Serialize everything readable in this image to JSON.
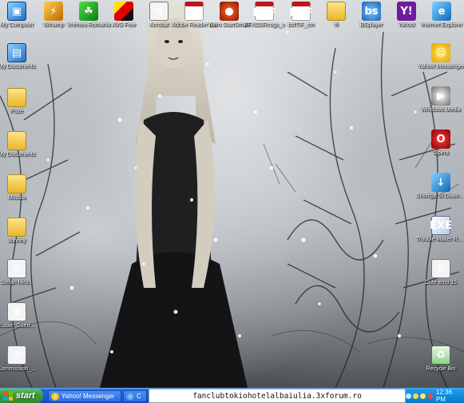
{
  "desktop": {
    "icons_top_row": [
      {
        "label": "My Computer",
        "icon": "computer-icon"
      },
      {
        "label": "Winamp",
        "icon": "winamp-icon"
      },
      {
        "label": "Vremea Romania",
        "icon": "weather-icon"
      },
      {
        "label": "AVS Free",
        "icon": "avs-icon"
      },
      {
        "label": "Acrobat",
        "icon": "document-icon"
      },
      {
        "label": "Adobe Reader 8.0",
        "icon": "pdf-icon"
      },
      {
        "label": "Nero StartSmart",
        "icon": "nero-icon"
      },
      {
        "label": "FFXIZ8Rcogs_s",
        "icon": "pdf-icon"
      },
      {
        "label": "bsfTIF_sm",
        "icon": "pdf-icon"
      },
      {
        "label": "ffi",
        "icon": "folder-icon"
      },
      {
        "label": "BSplayer",
        "icon": "bsplayer-icon"
      },
      {
        "label": "Yahoo!",
        "icon": "yahoo-icon"
      },
      {
        "label": "Internet Explorer",
        "icon": "ie-icon"
      }
    ],
    "icons_left": [
      {
        "label": "My Documents",
        "icon": "my-documents-icon"
      },
      {
        "label": "Poze",
        "icon": "folder-icon"
      },
      {
        "label": "My Documents",
        "icon": "folder-icon"
      },
      {
        "label": "Muzica",
        "icon": "folder-icon"
      },
      {
        "label": "Johnny",
        "icon": "folder-icon"
      },
      {
        "label": "Stefan Hiru...",
        "icon": "document-icon"
      },
      {
        "label": "Eddie_Guerr...",
        "icon": "document-icon"
      },
      {
        "label": "Commission_...",
        "icon": "document-icon"
      }
    ],
    "icons_right": [
      {
        "label": "Yahoo! Messenger",
        "icon": "smiley-icon"
      },
      {
        "label": "Windows Media",
        "icon": "media-player-icon"
      },
      {
        "label": "Opera",
        "icon": "opera-icon"
      },
      {
        "label": "Shortcut to Downloader",
        "icon": "shortcut-icon"
      },
      {
        "label": "Trouble Maker Rotten",
        "icon": "exe-icon"
      },
      {
        "label": "Cute emo 15",
        "icon": "document-icon"
      },
      {
        "label": "Recycle Bin",
        "icon": "recycle-bin-icon"
      }
    ]
  },
  "taskbar": {
    "start_label": "start",
    "tasks": [
      {
        "label": "Yahoo! Messenger",
        "icon": "yahoo-smiley-icon"
      },
      {
        "label": "C",
        "icon": "browser-icon"
      }
    ],
    "url_overlay": "fanclubtokiohotelalbaiulia.3xforum.ro",
    "clock": "12:36 PM"
  }
}
